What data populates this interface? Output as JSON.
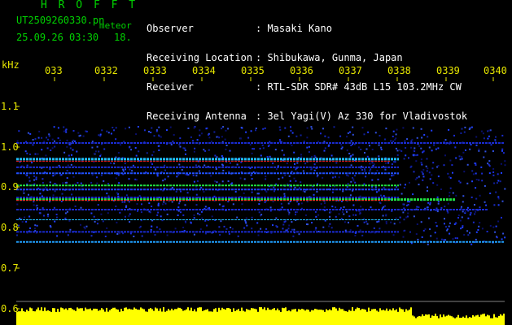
{
  "header": {
    "title": "H R O F F T",
    "filename_main": "UT2509260330.pn",
    "filename_suffix": "meteor",
    "date_time": "25.09.26 03:30",
    "count": "18.",
    "info": [
      {
        "label": "Observer",
        "value": ": Masaki Kano"
      },
      {
        "label": "Receiving Location",
        "value": ": Shibukawa, Gunma, Japan"
      },
      {
        "label": "Receiver",
        "value": ": RTL-SDR SDR# 43dB L15 103.2MHz CW"
      },
      {
        "label": "Receiving Antenna",
        "value": ": 3el Yagi(V) Az 330 for Vladivostok"
      }
    ]
  },
  "axes": {
    "y_unit": "kHz",
    "y_ticks": [
      "1.1",
      "1.0",
      "0.9",
      "0.8",
      "0.7",
      "0.6"
    ],
    "x_ticks": [
      "033",
      "0332",
      "0333",
      "0334",
      "0335",
      "0336",
      "0337",
      "0338",
      "0339",
      "0340"
    ]
  },
  "colors": {
    "text_green": "#00d200",
    "text_yellow": "#e6e600",
    "band_red": "#ff2020",
    "band_green": "#20e040",
    "noise_blue": "#1a2bd0",
    "level_yellow": "#ffff00"
  }
}
